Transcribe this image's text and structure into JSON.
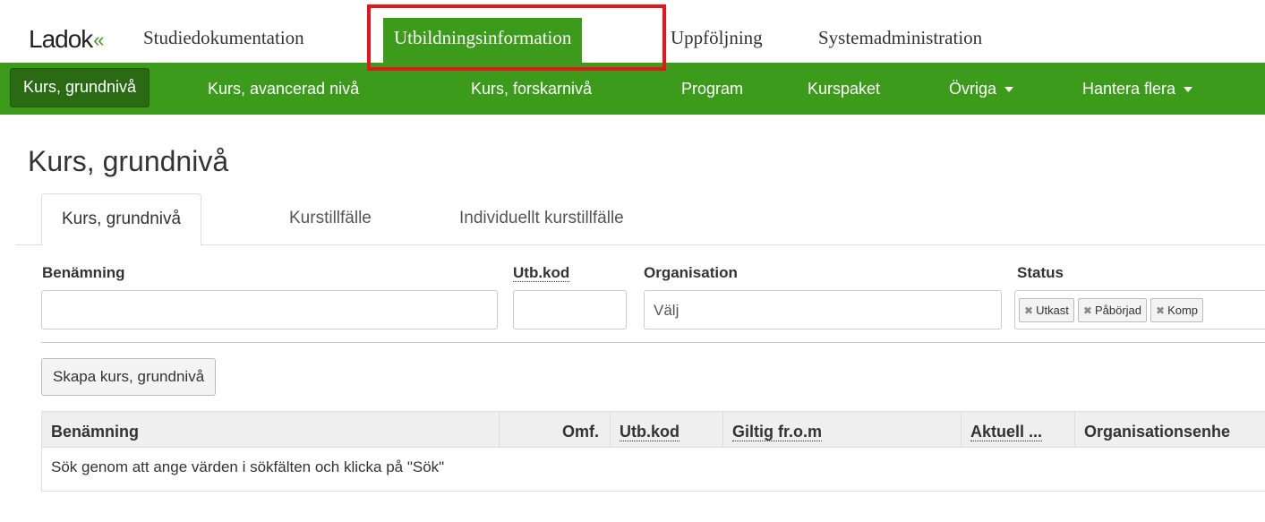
{
  "app": {
    "logo": "Ladok",
    "modules": [
      "Studiedokumentation",
      "Utbildningsinformation",
      "Uppföljning",
      "Systemadministration"
    ],
    "active_module": "Utbildningsinformation",
    "highlight_color": "#e8141b"
  },
  "nav": {
    "items": [
      "Kurs, grundnivå",
      "Kurs, avancerad nivå",
      "Kurs, forskarnivå",
      "Program",
      "Kurspaket",
      "Övriga",
      "Hantera flera"
    ],
    "active": "Kurs, grundnivå",
    "color": "#3d9b1c"
  },
  "page_title": "Kurs, grundnivå",
  "tabs": [
    "Kurs, grundnivå",
    "Kurstillfälle",
    "Individuellt kurstillfälle"
  ],
  "filters": {
    "benamning_label": "Benämning",
    "benamning_value": "",
    "utbkod_label": "Utb.kod",
    "utbkod_value": "",
    "organisation_label": "Organisation",
    "organisation_placeholder": "Välj",
    "status_label": "Status",
    "status_chips": [
      "Utkast",
      "Påbörjad",
      "Komp"
    ]
  },
  "create_button": "Skapa kurs, grundnivå",
  "results": {
    "columns": [
      "Benämning",
      "Omf.",
      "Utb.kod",
      "Giltig fr.o.m",
      "Aktuell ...",
      "Organisationsenhe"
    ],
    "empty_message": "Sök genom att ange värden i sökfälten och klicka på \"Sök\""
  }
}
